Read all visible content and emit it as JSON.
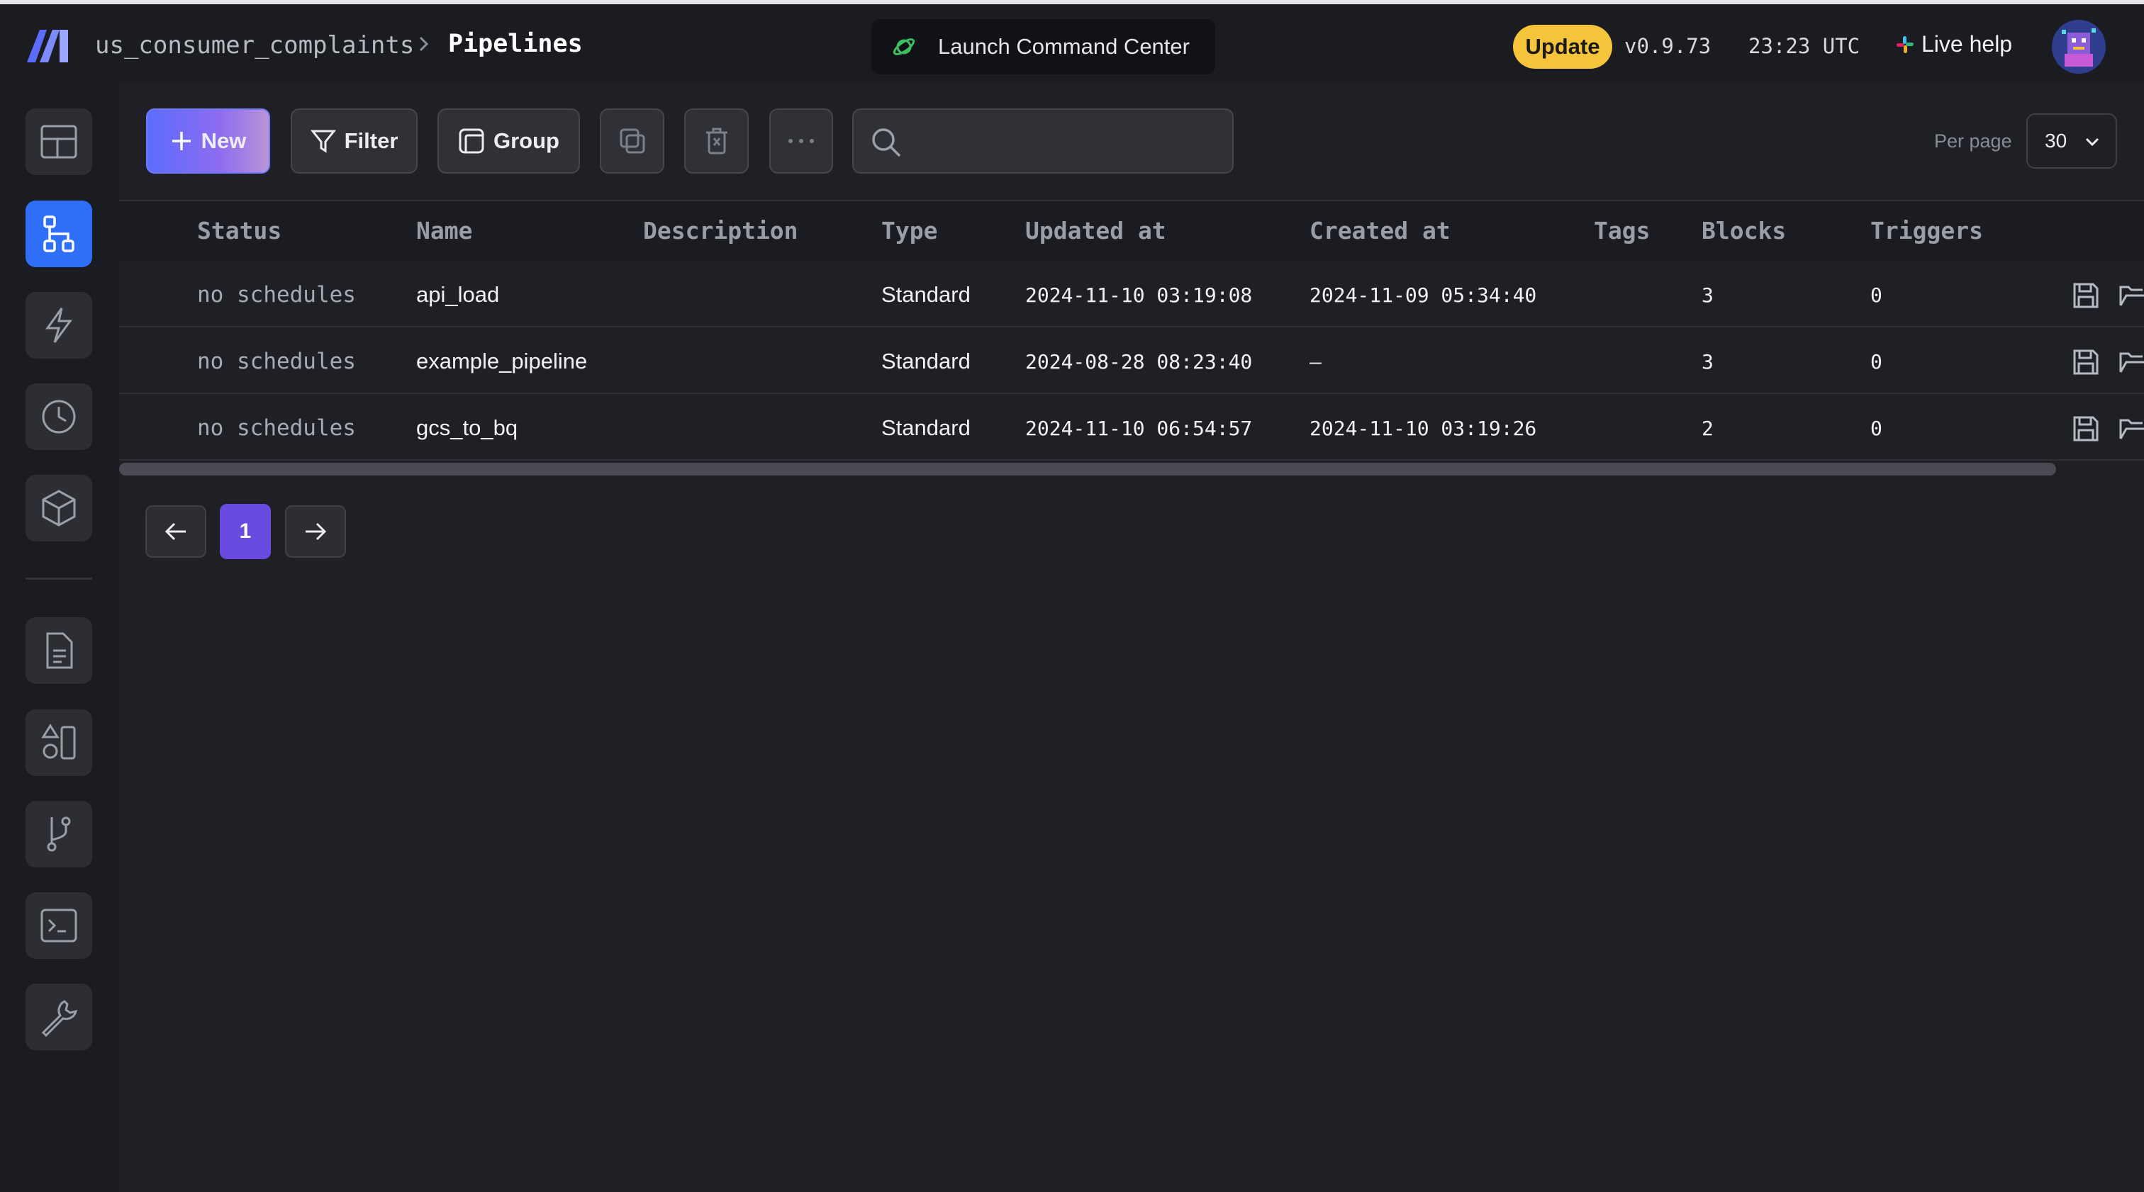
{
  "header": {
    "breadcrumb_project": "us_consumer_complaints",
    "breadcrumb_page": "Pipelines",
    "launch_label": "Launch Command Center",
    "update_label": "Update",
    "version": "v0.9.73",
    "time": "23:23 UTC",
    "live_help_label": "Live help"
  },
  "sidebar": {
    "items": [
      {
        "icon": "layout-icon",
        "active": false
      },
      {
        "icon": "pipeline-icon",
        "active": true
      },
      {
        "icon": "lightning-icon",
        "active": false
      },
      {
        "icon": "clock-icon",
        "active": false
      },
      {
        "icon": "cube-icon",
        "active": false
      },
      {
        "icon": "file-icon",
        "active": false
      },
      {
        "icon": "shapes-icon",
        "active": false
      },
      {
        "icon": "git-branch-icon",
        "active": false
      },
      {
        "icon": "terminal-icon",
        "active": false
      },
      {
        "icon": "wrench-icon",
        "active": false
      }
    ]
  },
  "toolbar": {
    "new_label": "New",
    "filter_label": "Filter",
    "group_label": "Group",
    "search_value": "",
    "per_page_label": "Per page",
    "per_page_value": "30"
  },
  "table": {
    "columns": [
      "Status",
      "Name",
      "Description",
      "Type",
      "Updated at",
      "Created at",
      "Tags",
      "Blocks",
      "Triggers"
    ],
    "rows": [
      {
        "status": "no schedules",
        "name": "api_load",
        "description": "",
        "type": "Standard",
        "updated": "2024-11-10 03:19:08",
        "created": "2024-11-09 05:34:40",
        "tags": "",
        "blocks": "3",
        "triggers": "0"
      },
      {
        "status": "no schedules",
        "name": "example_pipeline",
        "description": "",
        "type": "Standard",
        "updated": "2024-08-28 08:23:40",
        "created": "—",
        "tags": "",
        "blocks": "3",
        "triggers": "0"
      },
      {
        "status": "no schedules",
        "name": "gcs_to_bq",
        "description": "",
        "type": "Standard",
        "updated": "2024-11-10 06:54:57",
        "created": "2024-11-10 03:19:26",
        "tags": "",
        "blocks": "2",
        "triggers": "0"
      }
    ]
  },
  "pagination": {
    "current_page": "1"
  },
  "colors": {
    "accent": "#2f6ef7",
    "update_badge": "#f5c43a",
    "page_active": "#6a4be0",
    "background": "#1f2026"
  }
}
